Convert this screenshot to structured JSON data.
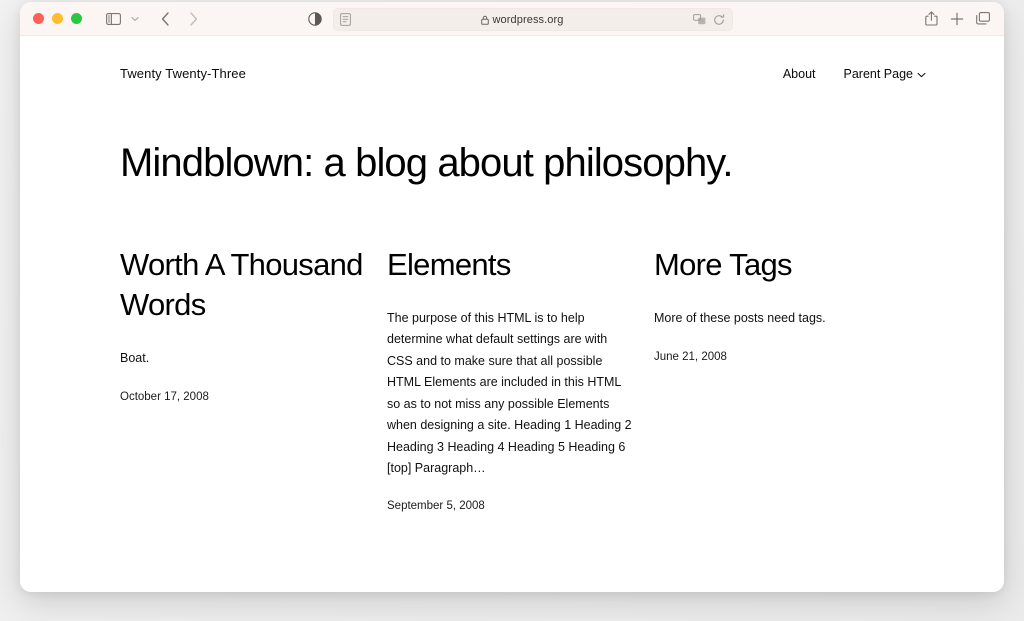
{
  "browser": {
    "traffic_lights": [
      "close",
      "minimize",
      "zoom"
    ],
    "colors": {
      "close": "#ff5f57",
      "minimize": "#febc2e",
      "zoom": "#28c840",
      "toolbar_bg": "#fbf6f3",
      "url_field_bg": "#f4eeea",
      "page_bg": "#ffffff"
    },
    "url": "wordpress.org",
    "secure_icon": "lock-icon",
    "sidebar_toggle_icon": "sidebar-toggle-icon",
    "sidebar_dropdown_icon": "chevron-down-icon",
    "back_icon": "chevron-left-icon",
    "forward_icon": "chevron-right-icon",
    "appearance_icon": "contrast-icon",
    "reader_icon": "reader-view-icon",
    "extensions_icon": "extensions-icon",
    "reload_icon": "reload-icon",
    "share_icon": "share-icon",
    "new_tab_icon": "plus-icon",
    "tab_overview_icon": "tab-overview-icon"
  },
  "site": {
    "title": "Twenty Twenty-Three",
    "nav": [
      {
        "label": "About",
        "has_submenu": false
      },
      {
        "label": "Parent Page",
        "has_submenu": true,
        "caret": "⌄"
      }
    ],
    "hero_title": "Mindblown: a blog about philosophy."
  },
  "posts": [
    {
      "title": "Worth A Thousand Words",
      "excerpt": "Boat.",
      "date": "October 17, 2008"
    },
    {
      "title": "Elements",
      "excerpt": "The purpose of this HTML is to help determine what default settings are with CSS and to make sure that all possible HTML Elements are included in this HTML so as to not miss any possible Elements when designing a site. Heading 1 Heading 2 Heading 3 Heading 4 Heading 5 Heading 6 [top] Paragraph…",
      "date": "September 5, 2008"
    },
    {
      "title": "More Tags",
      "excerpt": "More of these posts need tags.",
      "date": "June 21, 2008"
    }
  ]
}
